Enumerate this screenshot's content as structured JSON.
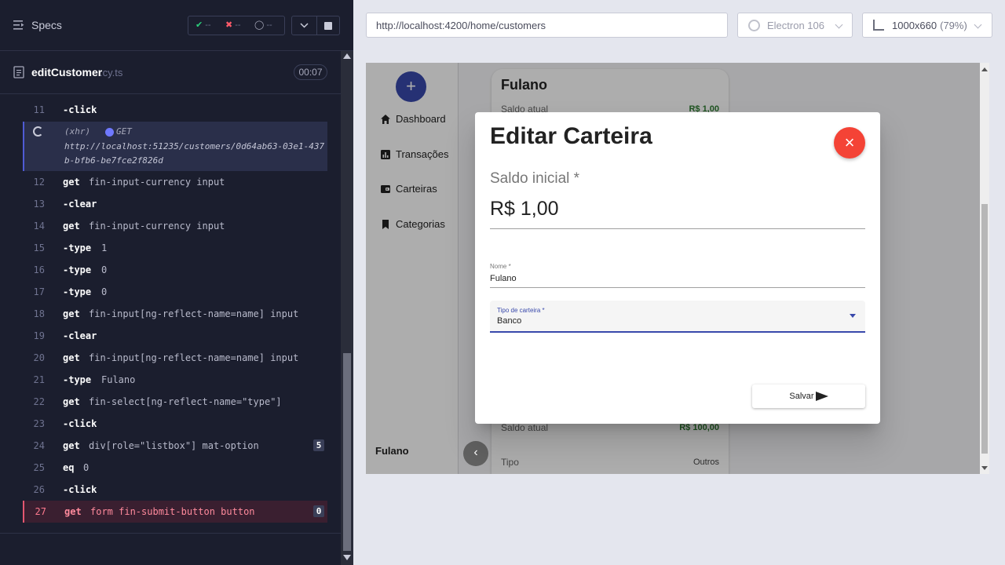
{
  "reporter": {
    "specs_label": "Specs",
    "stats": {
      "passed": "--",
      "failed": "--",
      "pending": "--"
    },
    "file": {
      "name": "editCustomer",
      "ext": ".cy.ts",
      "duration": "00:07"
    },
    "xhr": {
      "type": "(xhr)",
      "method": "GET",
      "url": "http://localhost:51235/customers/0d64ab63-03e1-437b-bfb6-be7fce2f826d"
    },
    "commands": [
      {
        "num": "11",
        "name": "-click",
        "msg": "",
        "badge": ""
      },
      {
        "num": "12",
        "name": "get",
        "msg": "fin-input-currency input",
        "badge": ""
      },
      {
        "num": "13",
        "name": "-clear",
        "msg": "",
        "badge": ""
      },
      {
        "num": "14",
        "name": "get",
        "msg": "fin-input-currency input",
        "badge": ""
      },
      {
        "num": "15",
        "name": "-type",
        "msg": "1",
        "badge": ""
      },
      {
        "num": "16",
        "name": "-type",
        "msg": "0",
        "badge": ""
      },
      {
        "num": "17",
        "name": "-type",
        "msg": "0",
        "badge": ""
      },
      {
        "num": "18",
        "name": "get",
        "msg": "fin-input[ng-reflect-name=name] input",
        "badge": ""
      },
      {
        "num": "19",
        "name": "-clear",
        "msg": "",
        "badge": ""
      },
      {
        "num": "20",
        "name": "get",
        "msg": "fin-input[ng-reflect-name=name] input",
        "badge": ""
      },
      {
        "num": "21",
        "name": "-type",
        "msg": "Fulano",
        "badge": ""
      },
      {
        "num": "22",
        "name": "get",
        "msg": "fin-select[ng-reflect-name=\"type\"]",
        "badge": ""
      },
      {
        "num": "23",
        "name": "-click",
        "msg": "",
        "badge": ""
      },
      {
        "num": "24",
        "name": "get",
        "msg": "div[role=\"listbox\"] mat-option",
        "badge": "5"
      },
      {
        "num": "25",
        "name": "eq",
        "msg": "0",
        "badge": ""
      },
      {
        "num": "26",
        "name": "-click",
        "msg": "",
        "badge": ""
      },
      {
        "num": "27",
        "name": "get",
        "msg": "form fin-submit-button button",
        "badge": "0"
      }
    ]
  },
  "browser": {
    "url": "http://localhost:4200/home/customers",
    "browser_name": "Electron 106",
    "viewport": "1000x660",
    "scale": "(79%)"
  },
  "app": {
    "sidebar": {
      "fab_label": "+",
      "items": [
        {
          "label": "Dashboard"
        },
        {
          "label": "Transações"
        },
        {
          "label": "Carteiras"
        },
        {
          "label": "Categorias"
        }
      ],
      "user": "Fulano",
      "collapse_label": "‹"
    },
    "cards": {
      "first": {
        "title": "Fulano",
        "saldo_label": "Saldo atual",
        "saldo_value": "R$ 1,00"
      },
      "second": {
        "saldo_label": "Saldo atual",
        "saldo_value": "R$ 100,00",
        "tipo_label": "Tipo",
        "tipo_value": "Outros"
      }
    },
    "dialog": {
      "title": "Editar Carteira",
      "close_label": "×",
      "currency_label": "Saldo inicial *",
      "currency_value": "R$ 1,00",
      "name_label": "Nome *",
      "name_value": "Fulano",
      "type_label": "Tipo de carteira *",
      "type_value": "Banco",
      "save_label": "Salvar"
    }
  },
  "colors": {
    "reporter_bg": "#1b1e2e",
    "primary": "#3949ab",
    "danger": "#f44336",
    "failed_row": "#3a1f30"
  }
}
